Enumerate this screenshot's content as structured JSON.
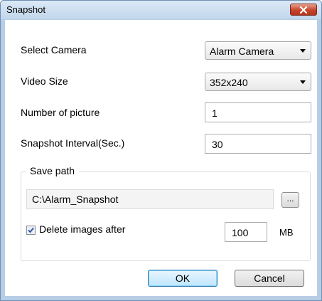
{
  "window": {
    "title": "Snapshot"
  },
  "form": {
    "select_camera_label": "Select Camera",
    "select_camera_value": "Alarm Camera",
    "video_size_label": "Video Size",
    "video_size_value": "352x240",
    "number_of_picture_label": "Number of picture",
    "number_of_picture_value": "1",
    "snapshot_interval_label": "Snapshot Interval(Sec.)",
    "snapshot_interval_value": "30"
  },
  "save_path": {
    "legend": "Save path",
    "path_value": "C:\\Alarm_Snapshot",
    "browse_label": "...",
    "delete_label": "Delete images after",
    "delete_checked": true,
    "delete_size_value": "100",
    "delete_size_unit": "MB"
  },
  "buttons": {
    "ok_label": "OK",
    "cancel_label": "Cancel"
  },
  "icons": {
    "close": "close-icon",
    "dropdown": "chevron-down-icon",
    "check": "check-icon"
  },
  "colors": {
    "title_bar": "#c8dbef",
    "close_button": "#c7442b",
    "ok_button_border": "#3c7fb1"
  }
}
